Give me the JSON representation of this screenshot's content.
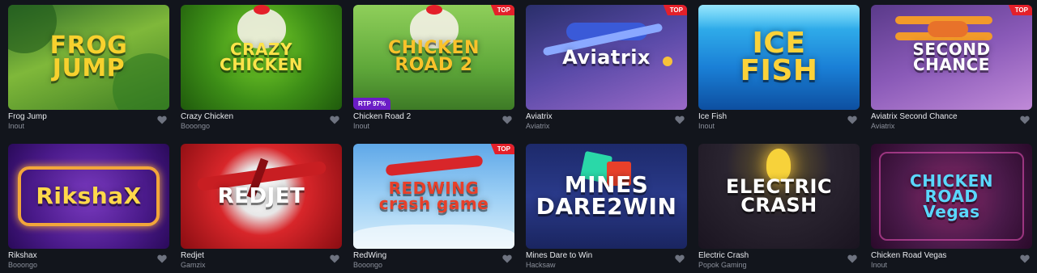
{
  "games": [
    {
      "title": "Frog Jump",
      "provider": "Inout",
      "art": "FROG\nJUMP",
      "badge": "",
      "rtp": "",
      "bg": "linear-gradient(160deg,#2f6b2a 0%,#7fb83a 45%,#3e7d23 100%)",
      "art_color": "#f7d12e",
      "art_size": "30px",
      "deco": "frog"
    },
    {
      "title": "Crazy Chicken",
      "provider": "Booongo",
      "art": "CRAZY\nCHICKEN",
      "badge": "",
      "rtp": "",
      "bg": "radial-gradient(circle at 50% 40%,#7ad22b 0%,#3d8e17 55%,#1f5a0c 100%)",
      "art_color": "#fde34a",
      "art_size": "20px",
      "deco": "chicken"
    },
    {
      "title": "Chicken Road 2",
      "provider": "Inout",
      "art": "CHICKEN\nROAD 2",
      "badge": "TOP",
      "rtp": "RTP 97%",
      "bg": "linear-gradient(180deg,#8fcf5a 0%,#5fa83a 60%,#3d7a26 100%)",
      "art_color": "#f9c22b",
      "art_size": "22px",
      "deco": "chicken"
    },
    {
      "title": "Aviatrix",
      "provider": "Aviatrix",
      "art": "Aviatrix",
      "badge": "TOP",
      "rtp": "",
      "bg": "linear-gradient(160deg,#2a2f6b 0%,#5a4aa8 50%,#9a6ac8 100%)",
      "art_color": "#ffffff",
      "art_size": "24px",
      "deco": "plane"
    },
    {
      "title": "Ice Fish",
      "provider": "Inout",
      "art": "ICE\nFISH",
      "badge": "",
      "rtp": "",
      "bg": "linear-gradient(180deg,#3cc6f5 0%,#1a7fd6 60%,#0d4fa0 100%)",
      "art_color": "#fbd23a",
      "art_size": "36px",
      "deco": "ice"
    },
    {
      "title": "Aviatrix Second Chance",
      "provider": "Aviatrix",
      "art": "SECOND\nCHANCE",
      "badge": "TOP",
      "rtp": "",
      "bg": "linear-gradient(160deg,#5a3a8a 0%,#8a5ab8 50%,#c08ad8 100%)",
      "art_color": "#ffffff",
      "art_size": "20px",
      "deco": "biplane"
    },
    {
      "title": "Rikshax",
      "provider": "Booongo",
      "art": "RikshaX",
      "badge": "",
      "rtp": "",
      "bg": "radial-gradient(circle at 50% 50%,#7a3ac0 0%,#4a1a8a 60%,#2a0a5a 100%)",
      "art_color": "#ffd84a",
      "art_size": "28px",
      "deco": "frame"
    },
    {
      "title": "Redjet",
      "provider": "Gamzix",
      "art": "REDJET",
      "badge": "",
      "rtp": "",
      "bg": "radial-gradient(circle at 50% 45%,#ffffff 0%,#e8e8e8 25%,#d8262a 45%,#8a0d12 100%)",
      "art_color": "#ffffff",
      "art_size": "26px",
      "deco": "redplane"
    },
    {
      "title": "RedWing",
      "provider": "Booongo",
      "art": "REDWING\ncrash game",
      "badge": "TOP",
      "rtp": "",
      "bg": "linear-gradient(180deg,#5fa8e8 0%,#9ccff5 50%,#d8eefa 100%)",
      "art_color": "#e8402a",
      "art_size": "20px",
      "deco": "redwing"
    },
    {
      "title": "Mines Dare to Win",
      "provider": "Hacksaw",
      "art": "MINES\nDARE2WIN",
      "badge": "",
      "rtp": "",
      "bg": "linear-gradient(180deg,#1d2a6b 0%,#2a3a8a 50%,#1a2560 100%)",
      "art_color": "#ffffff",
      "art_size": "28px",
      "deco": "mines"
    },
    {
      "title": "Electric Crash",
      "provider": "Popok Gaming",
      "art": "ELECTRIC\nCRASH",
      "badge": "",
      "rtp": "",
      "bg": "radial-gradient(circle at 50% 20%,#6a5a2a 0%,#2a2430 45%,#1a1420 100%)",
      "art_color": "#ffffff",
      "art_size": "24px",
      "deco": "bulb"
    },
    {
      "title": "Chicken Road Vegas",
      "provider": "Inout",
      "art": "CHICKEN\nROAD\nVegas",
      "badge": "",
      "rtp": "",
      "bg": "radial-gradient(circle at 50% 50%,#8a2a6a 0%,#4a1a4a 55%,#2a0a2a 100%)",
      "art_color": "#5ad8ff",
      "art_size": "20px",
      "deco": "vegas"
    }
  ],
  "colors": {
    "background": "#12151c",
    "top_badge": "#e4202a",
    "rtp_badge": "#6b1cc6",
    "heart": "#6e7380"
  },
  "icons": {
    "favorite": "heart-icon"
  }
}
